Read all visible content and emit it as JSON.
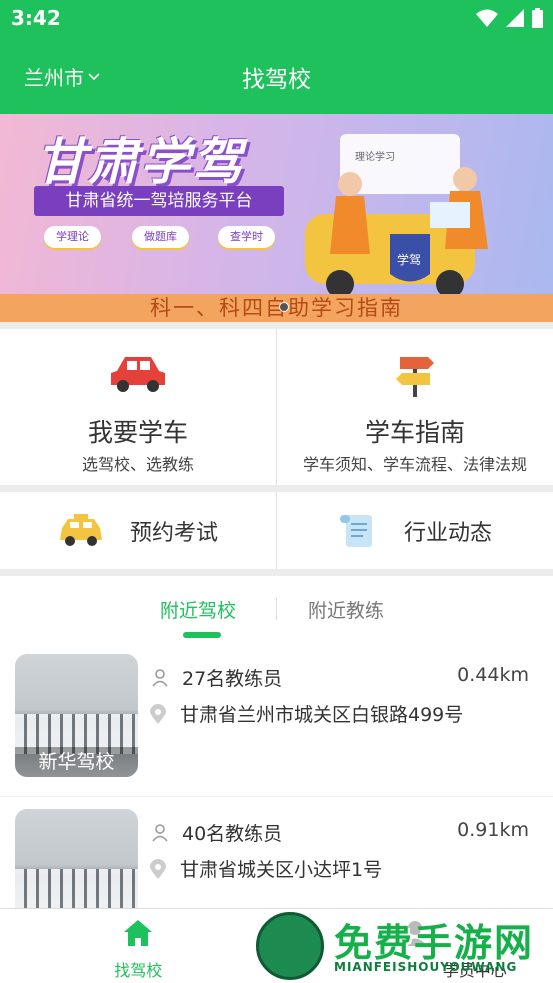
{
  "status_bar": {
    "time": "3:42",
    "icons": [
      "wifi-icon",
      "signal-icon",
      "battery-icon"
    ]
  },
  "header": {
    "city": "兰州市",
    "title": "找驾校"
  },
  "banner": {
    "title": "甘肃学驾",
    "subtitle": "甘肃省统一驾培服务平台",
    "pills": [
      "学理论",
      "做题库",
      "查学时"
    ],
    "bottom_text": "科一、科四自助学习指南",
    "book_label": "理论学习",
    "shield_label": "学驾"
  },
  "grid_top": [
    {
      "label": "我要学车",
      "desc": "选驾校、选教练",
      "icon": "car-icon"
    },
    {
      "label": "学车指南",
      "desc": "学车须知、学车流程、法律法规",
      "icon": "signpost-icon"
    }
  ],
  "grid_bottom": [
    {
      "label": "预约考试",
      "icon": "taxi-icon"
    },
    {
      "label": "行业动态",
      "icon": "scroll-icon"
    }
  ],
  "tabs": {
    "active": "附近驾校",
    "inactive": "附近教练"
  },
  "schools": [
    {
      "name": "新华驾校",
      "coaches": "27名教练员",
      "distance": "0.44km",
      "address": "甘肃省兰州市城关区白银路499号"
    },
    {
      "name": "",
      "coaches": "40名教练员",
      "distance": "0.91km",
      "address": "甘肃省城关区小达坪1号"
    }
  ],
  "bottom_nav": {
    "home": "找驾校",
    "profile": "学员中心"
  },
  "watermark": {
    "text": "免费手游网",
    "sub": "MIANFEISHOUYOUWANG"
  },
  "colors": {
    "accent": "#1ec15c",
    "banner_purple": "#7a3fbf",
    "banner_orange": "#f3a55f"
  }
}
